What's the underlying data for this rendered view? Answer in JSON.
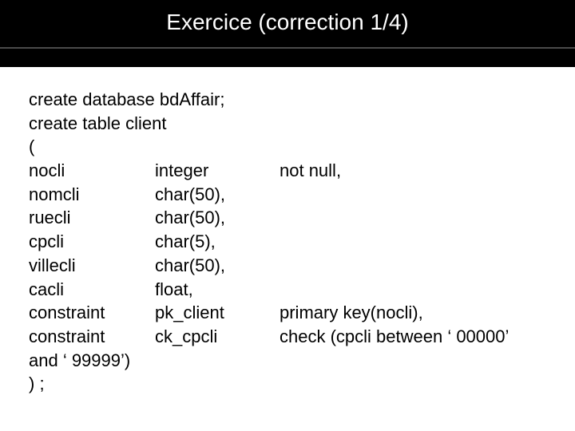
{
  "header": {
    "title": "Exercice (correction 1/4)"
  },
  "code": {
    "line1": "create database bdAffair;",
    "line2": "create table client",
    "line3": "(",
    "cols": [
      {
        "c1": "nocli",
        "c2": "integer",
        "c3": "not null,"
      },
      {
        "c1": "nomcli",
        "c2": "char(50),",
        "c3": ""
      },
      {
        "c1": "ruecli",
        "c2": "char(50),",
        "c3": ""
      },
      {
        "c1": "cpcli",
        "c2": "char(5),",
        "c3": ""
      },
      {
        "c1": "villecli",
        "c2": "char(50),",
        "c3": ""
      },
      {
        "c1": "cacli",
        "c2": "float,",
        "c3": ""
      },
      {
        "c1": "constraint",
        "c2": "pk_client",
        "c3": "primary key(nocli),"
      },
      {
        "c1": "constraint",
        "c2": "ck_cpcli",
        "c3": "check (cpcli between ‘ 00000’"
      }
    ],
    "line_after": "and ‘ 99999’)",
    "line_end": ") ;"
  }
}
